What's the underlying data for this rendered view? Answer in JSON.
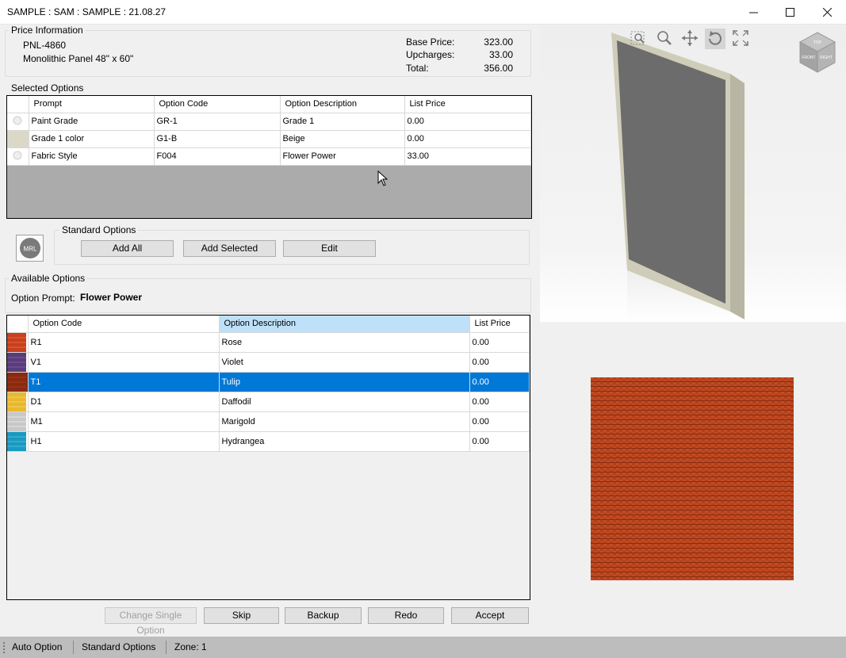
{
  "window": {
    "title": "SAMPLE : SAM : SAMPLE : 21.08.27"
  },
  "price_info": {
    "label": "Price Information",
    "part_number": "PNL-4860",
    "part_description": "Monolithic Panel 48\" x 60\"",
    "base_price_label": "Base Price:",
    "base_price": "323.00",
    "upcharges_label": "Upcharges:",
    "upcharges": "33.00",
    "total_label": "Total:",
    "total": "356.00"
  },
  "selected_options": {
    "label": "Selected Options",
    "columns": [
      "Prompt",
      "Option Code",
      "Option Description",
      "List Price"
    ],
    "rows": [
      {
        "prompt": "Paint Grade",
        "code": "GR-1",
        "description": "Grade 1",
        "price": "0.00",
        "swatch": "#f4f4f4"
      },
      {
        "prompt": "Grade 1 color",
        "code": "G1-B",
        "description": "Beige",
        "price": "0.00",
        "swatch": "#dcd8c8"
      },
      {
        "prompt": "Fabric Style",
        "code": "F004",
        "description": "Flower Power",
        "price": "33.00",
        "swatch": "#f4f4f4"
      }
    ]
  },
  "standard_options": {
    "label": "Standard Options",
    "logo_text": "MRL",
    "add_all": "Add All",
    "add_selected": "Add Selected",
    "edit": "Edit"
  },
  "available_options": {
    "label": "Available Options",
    "prompt_label": "Option Prompt:",
    "prompt_value": "Flower Power",
    "columns": [
      "Option Code",
      "Option Description",
      "List Price"
    ],
    "rows": [
      {
        "code": "R1",
        "description": "Rose",
        "price": "0.00",
        "swatch": "#c8401e"
      },
      {
        "code": "V1",
        "description": "Violet",
        "price": "0.00",
        "swatch": "#5a3c7a"
      },
      {
        "code": "T1",
        "description": "Tulip",
        "price": "0.00",
        "swatch": "#8a2a10"
      },
      {
        "code": "D1",
        "description": "Daffodil",
        "price": "0.00",
        "swatch": "#e8b830"
      },
      {
        "code": "M1",
        "description": "Marigold",
        "price": "0.00",
        "swatch": "#c8c8c8"
      },
      {
        "code": "H1",
        "description": "Hydrangea",
        "price": "0.00",
        "swatch": "#1a9ac0"
      }
    ],
    "selected_index": 2
  },
  "bottom_buttons": {
    "change_single": "Change Single Option",
    "skip": "Skip",
    "backup": "Backup",
    "redo": "Redo",
    "accept": "Accept"
  },
  "status": {
    "auto_option": "Auto Option",
    "standard_options": "Standard Options",
    "zone": "Zone: 1"
  },
  "viewer": {
    "icons": [
      "zoom-extents-icon",
      "zoom-icon",
      "pan-icon",
      "rotate-icon",
      "fullscreen-icon"
    ],
    "cube_top": "TOP",
    "cube_front": "FRONT",
    "cube_right": "RIGHT"
  },
  "colors": {
    "selection": "#0078d7",
    "header_highlight": "#bee0f8",
    "fabric": "#b2401c"
  }
}
